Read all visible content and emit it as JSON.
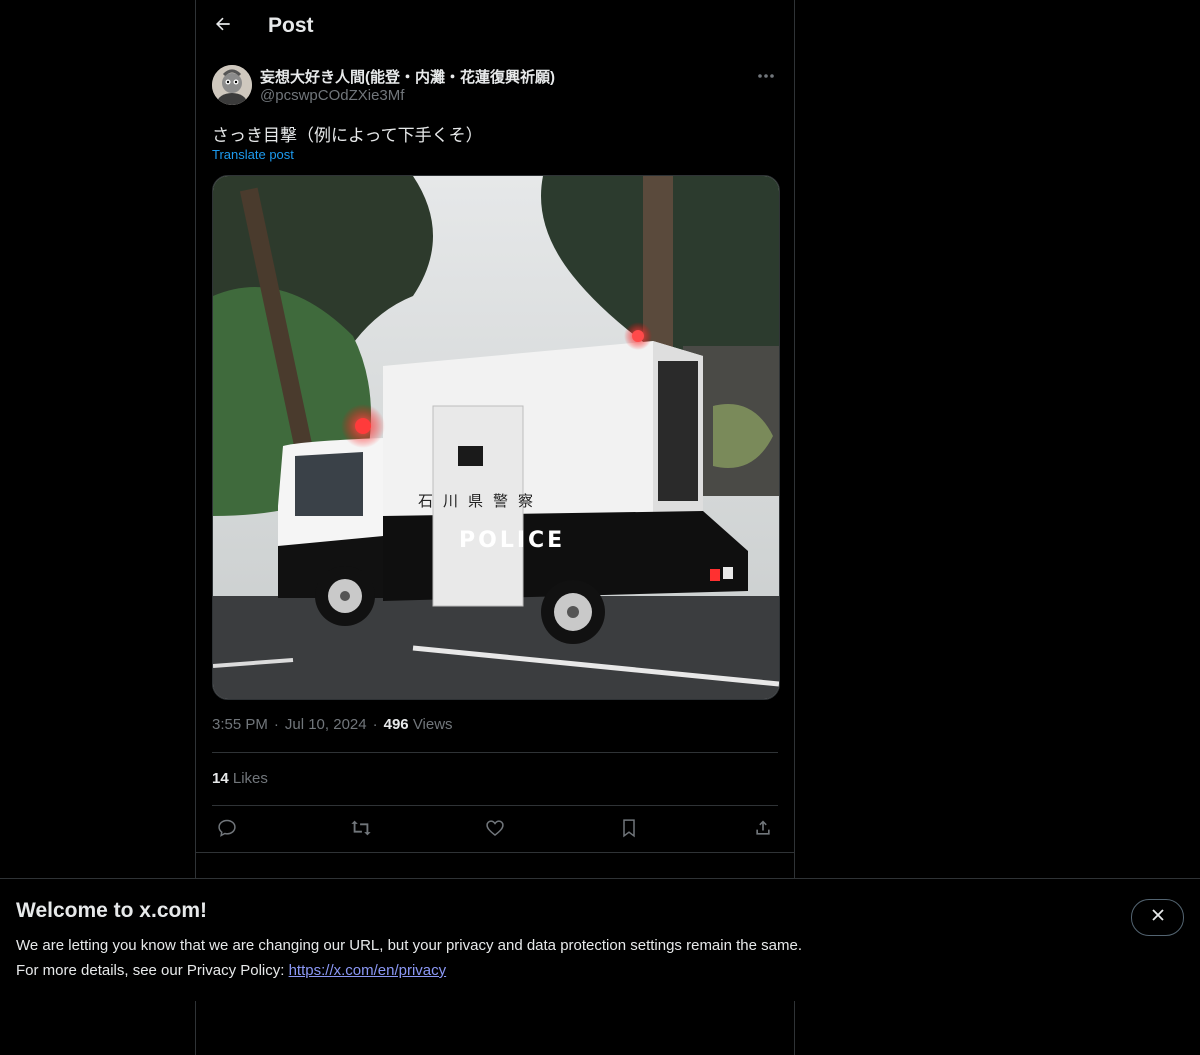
{
  "header": {
    "title": "Post",
    "back_icon": "arrow-left-icon"
  },
  "author": {
    "display_name": "妄想大好き人間(能登・内灘・花蓮復興祈願)",
    "handle": "@pcswpCOdZXie3Mf",
    "more_icon": "more-horizontal-icon"
  },
  "post": {
    "text": "さっき目撃（例によって下手くそ）",
    "translate_label": "Translate post",
    "media": {
      "kanji_label": "石川県警察",
      "police_label": "POLICE"
    },
    "time": "3:55 PM",
    "date": "Jul 10, 2024",
    "views_count": "496",
    "views_label": "Views",
    "likes_count": "14",
    "likes_label": "Likes"
  },
  "actions": [
    {
      "name": "reply",
      "icon": "reply-icon"
    },
    {
      "name": "repost",
      "icon": "repost-icon"
    },
    {
      "name": "like",
      "icon": "heart-icon"
    },
    {
      "name": "bookmark",
      "icon": "bookmark-icon"
    },
    {
      "name": "share",
      "icon": "share-icon"
    }
  ],
  "banner": {
    "title": "Welcome to x.com!",
    "line1": "We are letting you know that we are changing our URL, but your privacy and data protection settings remain the same.",
    "line2_prefix": "For more details, see our Privacy Policy: ",
    "link": "https://x.com/en/privacy",
    "close_icon": "close-icon"
  },
  "colors": {
    "background": "#000000",
    "text": "#e7e9ea",
    "muted": "#71767b",
    "accent": "#1d9bf0",
    "link": "#8b98f5",
    "border": "#2f3336"
  }
}
